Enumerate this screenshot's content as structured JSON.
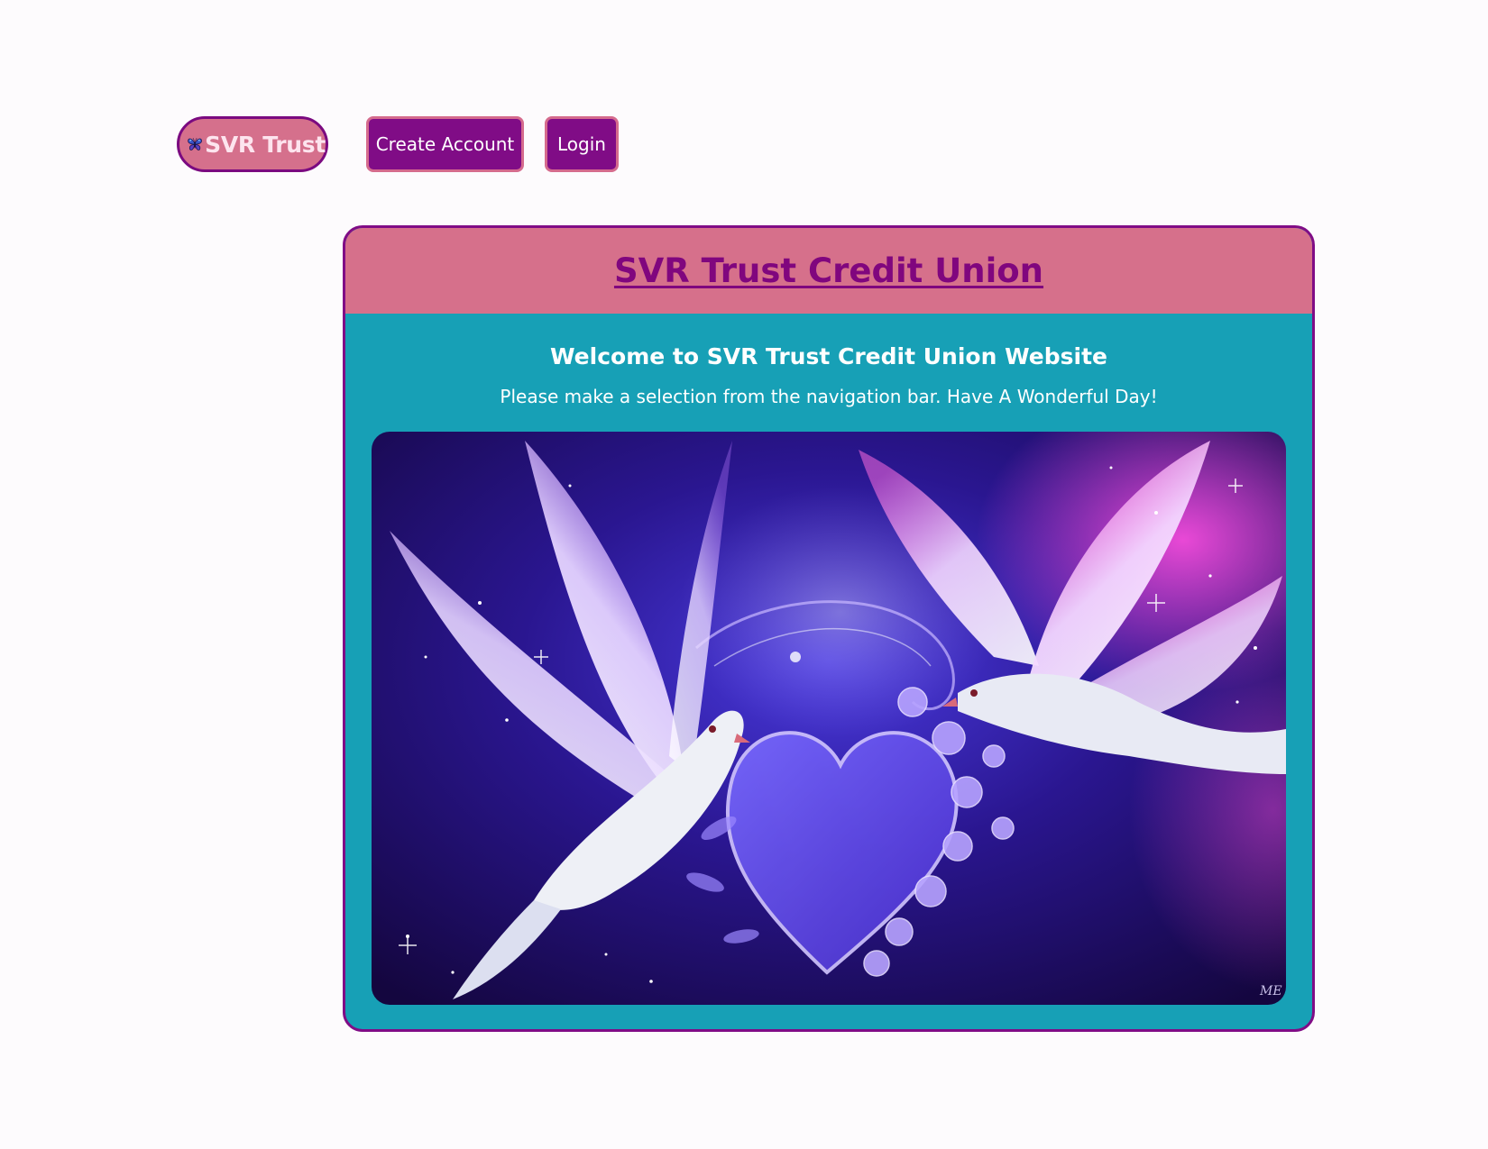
{
  "nav": {
    "brand_label": "SVR Trust",
    "brand_icon": "butterfly-icon",
    "create_account_label": "Create Account",
    "login_label": "Login"
  },
  "card": {
    "title": "SVR Trust Credit Union",
    "welcome_heading": "Welcome to SVR Trust Credit Union Website",
    "subtitle": "Please make a selection from the navigation bar. Have A Wonderful Day!",
    "hero_image": "doves-heart-illustration",
    "hero_signature": "ME"
  },
  "colors": {
    "accent_purple": "#800c86",
    "pink": "#d6708b",
    "teal": "#17a0b6",
    "white": "#ffffff"
  }
}
